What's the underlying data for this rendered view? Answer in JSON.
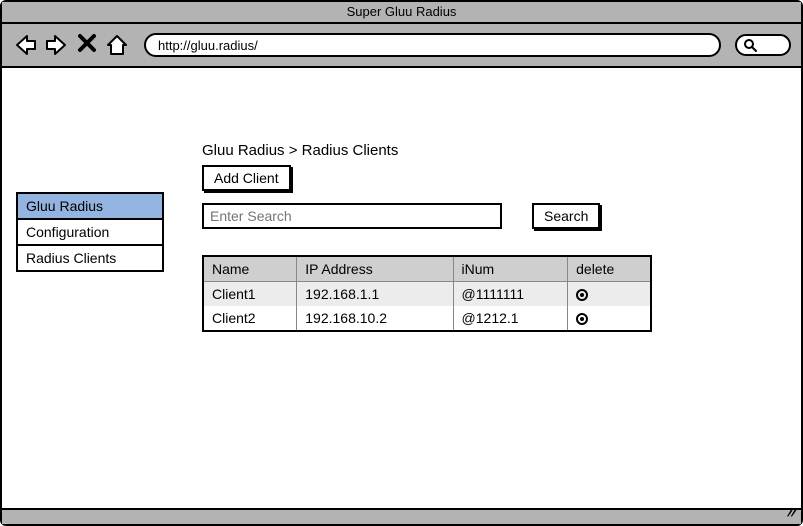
{
  "window": {
    "title": "Super Gluu Radius",
    "url": "http://gluu.radius/"
  },
  "sidebar": {
    "items": [
      {
        "label": "Gluu Radius",
        "selected": true
      },
      {
        "label": "Configuration",
        "selected": false
      },
      {
        "label": "Radius Clients",
        "selected": false
      }
    ]
  },
  "breadcrumb": {
    "text": "Gluu Radius > Radius Clients"
  },
  "buttons": {
    "add_client": "Add Client",
    "search": "Search"
  },
  "search": {
    "placeholder": "Enter Search",
    "value": ""
  },
  "table": {
    "columns": [
      "Name",
      "IP Address",
      "iNum",
      "delete"
    ],
    "rows": [
      {
        "name": "Client1",
        "ip": "192.168.1.1",
        "inum": "@1111111"
      },
      {
        "name": "Client2",
        "ip": "192.168.10.2",
        "inum": "@1212.1"
      }
    ]
  }
}
